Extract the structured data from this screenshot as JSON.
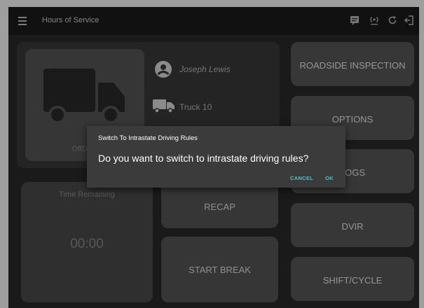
{
  "header": {
    "title": "Hours of Service",
    "icons": [
      "menu-icon",
      "chat-icon",
      "signal-icon",
      "refresh-icon",
      "logout-icon"
    ]
  },
  "status": {
    "label": "OffDuty"
  },
  "driver": {
    "name": "Joseph Lewis",
    "truck": "Truck 10"
  },
  "time_remaining": {
    "label": "Time Remaining",
    "value": "00:00"
  },
  "center_buttons": {
    "recap": "RECAP",
    "start_break": "START BREAK"
  },
  "menu": {
    "roadside": "ROADSIDE INSPECTION",
    "options": "OPTIONS",
    "logs": "LOGS",
    "dvir": "DVIR",
    "shift_cycle": "SHIFT/CYCLE"
  },
  "dialog": {
    "title": "Switch To Intrastate Driving Rules",
    "message": "Do you want to switch to intrastate driving rules?",
    "cancel": "CANCEL",
    "ok": "OK"
  },
  "colors": {
    "accent": "#4fc3c9",
    "background": "#2a2a2a",
    "topbar": "#1c1c1c"
  }
}
